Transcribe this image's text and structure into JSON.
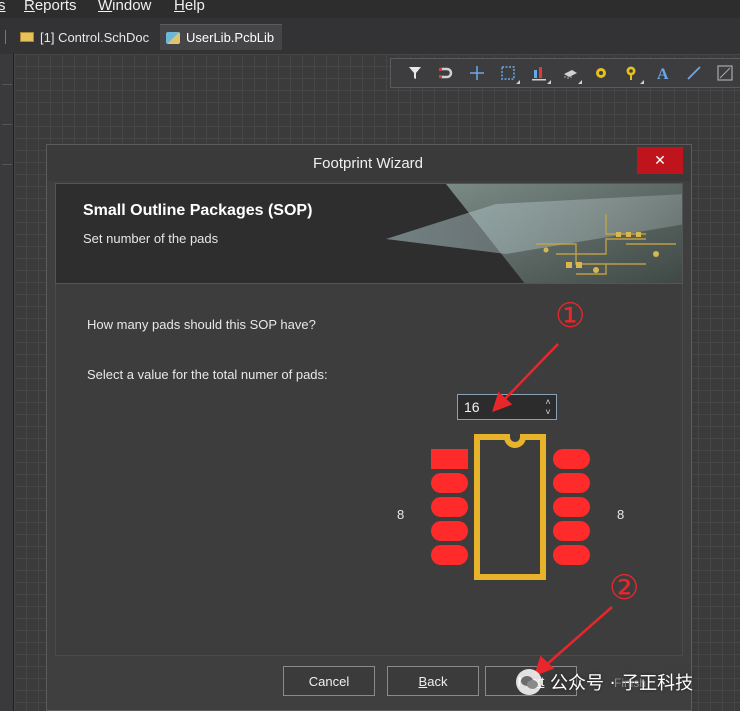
{
  "menubar": {
    "items": [
      {
        "prefix": "",
        "mnemonic": "s",
        "rest": ""
      },
      {
        "prefix": "",
        "mnemonic": "R",
        "rest": "eports"
      },
      {
        "prefix": "",
        "mnemonic": "W",
        "rest": "indow"
      },
      {
        "prefix": "",
        "mnemonic": "H",
        "rest": "elp"
      }
    ]
  },
  "tabs": [
    {
      "label": "[1] Control.SchDoc",
      "icon": "schematic-doc-icon",
      "active": false
    },
    {
      "label": "UserLib.PcbLib",
      "icon": "pcb-lib-icon",
      "active": true
    }
  ],
  "toolbar": {
    "icons": [
      "filter-icon",
      "magnet-icon",
      "crosshair-icon",
      "select-rect-icon",
      "align-icon",
      "component-icon",
      "pad-icon",
      "via-icon",
      "text-icon",
      "line-icon",
      "region-icon"
    ]
  },
  "dialog": {
    "title": "Footprint Wizard",
    "close_symbol": "✕",
    "header": {
      "title": "Small Outline Packages (SOP)",
      "subtitle": "Set number of the pads"
    },
    "question": "How many pads should this SOP have?",
    "instruction": "Select a value for the total numer of pads:",
    "pads_value": "16",
    "spin_up": "˄",
    "spin_down": "˅",
    "left_count": "8",
    "right_count": "8",
    "buttons": {
      "cancel": "Cancel",
      "back_mnemonic": "B",
      "back_rest": "ack",
      "next_prefix": "Ne",
      "next_rest": "xt"
    }
  },
  "preview": {
    "pad_color": "#ff2a2a",
    "body_outline_color": "#e6b32a",
    "pads_per_side": 8
  },
  "annotations": {
    "marker_1": "①",
    "marker_2": "②",
    "color": "#e8262b"
  },
  "watermark": {
    "text": "公众号 · 子正科技",
    "faded": "Finish"
  }
}
